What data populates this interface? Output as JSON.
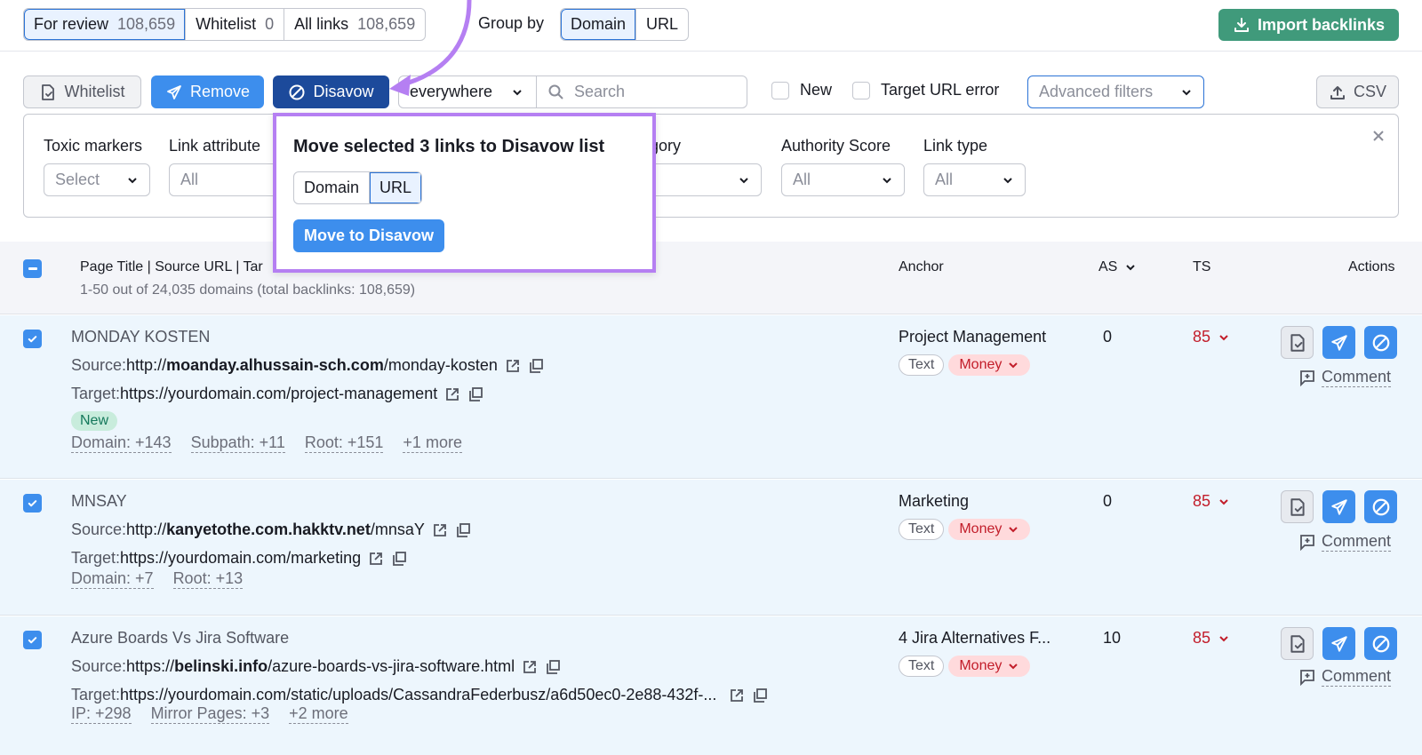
{
  "tabs": [
    {
      "label": "For review",
      "count": "108,659",
      "active": true
    },
    {
      "label": "Whitelist",
      "count": "0",
      "active": false
    },
    {
      "label": "All links",
      "count": "108,659",
      "active": false
    }
  ],
  "group_by": {
    "label": "Group by",
    "options": [
      "Domain",
      "URL"
    ],
    "selected": "Domain"
  },
  "import_button": {
    "label": "Import backlinks",
    "icon": "download-icon",
    "color": "#409a7b"
  },
  "toolbar": {
    "whitelist_label": "Whitelist",
    "remove_label": "Remove",
    "disavow_label": "Disavow",
    "scope_value": "Everywhere",
    "scope_visible": "everywhere",
    "search_placeholder": "Search",
    "new_label": "New",
    "target_error_label": "Target URL error",
    "advanced_filters_label": "Advanced filters",
    "csv_label": "CSV"
  },
  "filters": [
    {
      "label": "Toxic markers",
      "value": "Select"
    },
    {
      "label": "Link attribute",
      "value": "All"
    },
    {
      "label": "Category",
      "value": ""
    },
    {
      "label": "Authority Score",
      "value": "All"
    },
    {
      "label": "Link type",
      "value": "All"
    }
  ],
  "filters_visible": {
    "link_attribute_label": "Link attribute",
    "category_label_partial": "egory"
  },
  "popover": {
    "title": "Move selected 3 links to Disavow list",
    "options": [
      "Domain",
      "URL"
    ],
    "selected": "URL",
    "button_label": "Move to Disavow"
  },
  "table": {
    "headers": {
      "main": "Page Title | Source URL | Tar",
      "anchor": "Anchor",
      "as": "AS",
      "ts": "TS",
      "actions": "Actions"
    },
    "summary": "1-50 out of 24,035 domains (total backlinks: 108,659)",
    "rows": [
      {
        "checked": true,
        "title": "MONDAY KOSTEN",
        "source_prefix": "Source: ",
        "source_scheme": "http://",
        "source_domain": "moanday.alhussain-sch.com",
        "source_path": "/monday-kosten",
        "target_prefix": "Target: ",
        "target_url": "https://yourdomain.com/project-management",
        "badge": "New",
        "metas": [
          "Domain: +143",
          "Subpath: +11",
          "Root: +151",
          "+1 more"
        ],
        "anchor": "Project Management",
        "tags": [
          "Text",
          "Money"
        ],
        "as": "0",
        "ts": "85",
        "comment": "Comment"
      },
      {
        "checked": true,
        "title": "MNSAY",
        "source_prefix": "Source: ",
        "source_scheme": "http://",
        "source_domain": "kanyetothe.com.hakktv.net",
        "source_path": "/mnsaY",
        "target_prefix": "Target: ",
        "target_url": "https://yourdomain.com/marketing",
        "badge": "",
        "metas": [
          "Domain: +7",
          "Root: +13"
        ],
        "anchor": "Marketing",
        "tags": [
          "Text",
          "Money"
        ],
        "as": "0",
        "ts": "85",
        "comment": "Comment"
      },
      {
        "checked": true,
        "title": "Azure Boards Vs Jira Software",
        "source_prefix": "Source: ",
        "source_scheme": "https://",
        "source_domain": "belinski.info",
        "source_path": "/azure-boards-vs-jira-software.html",
        "target_prefix": "Target: ",
        "target_url": "https://yourdomain.com/static/uploads/CassandraFederbusz/a6d50ec0-2e88-432f-...",
        "badge": "",
        "metas": [
          "IP: +298",
          "Mirror Pages: +3",
          "+2 more"
        ],
        "anchor": "4 Jira Alternatives F...",
        "tags": [
          "Text",
          "Money"
        ],
        "as": "10",
        "ts": "85",
        "comment": "Comment"
      }
    ]
  },
  "colors": {
    "primary_blue": "#3d8eed",
    "disavow_navy": "#1c4a9b",
    "toxic_red": "#c21d2a",
    "highlight_purple": "#b57ff2",
    "row_selected_bg": "#edf6fd",
    "new_badge_bg": "#c8ecdc"
  }
}
